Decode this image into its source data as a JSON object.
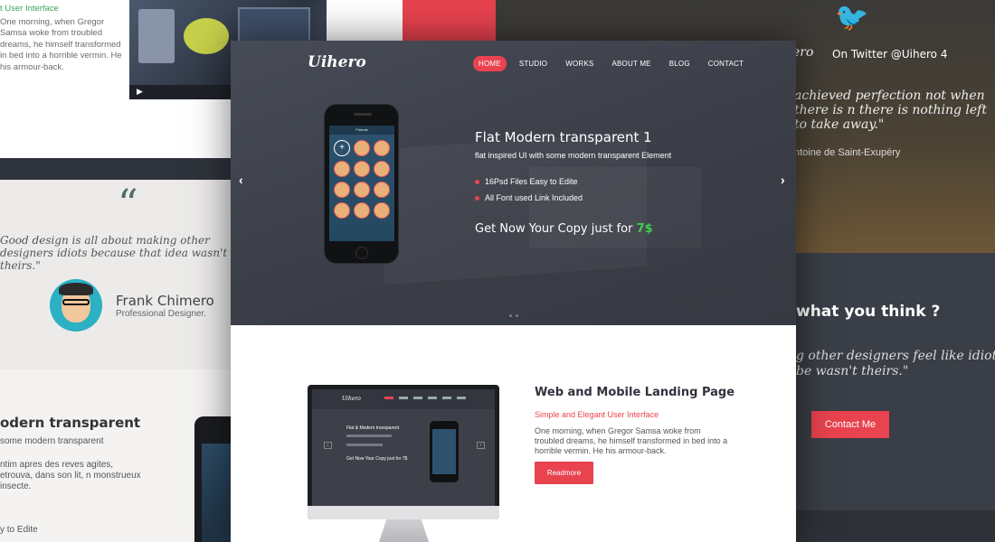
{
  "background": {
    "left_top": {
      "tag": "t User Interface",
      "body": "One morning, when Gregor Samsa woke from troubled dreams, he himself transformed in bed into a horrible vermin. He his armour-back."
    },
    "right_top": {
      "handle": "On Twitter @Uihero 4",
      "brand": "ero",
      "quote": "achieved perfection not when there is n there is nothing left to take away.\"",
      "author": "ntoine de Saint-Exupéry"
    },
    "left_mid": {
      "quote": "Good design is all about making other designers idiots because that idea wasn't theirs.\"",
      "name": "Frank Chimero",
      "role": "Professional Designer."
    },
    "left_bottom": {
      "heading": "odern transparent",
      "line1": "some modern transparent",
      "line2": "ntim apres des reves agites, etrouva, dans son lit, n monstrueux insecte.",
      "line3": "y to Edite"
    },
    "right_dark": {
      "heading": "what you think ?",
      "quote": "g other designers feel like idiots be wasn't theirs.\"",
      "button": "Contact Me"
    }
  },
  "header": {
    "logo": "Uihero",
    "nav": [
      {
        "label": "HOME",
        "active": true
      },
      {
        "label": "STUDIO",
        "active": false
      },
      {
        "label": "WORKS",
        "active": false
      },
      {
        "label": "ABOUT ME",
        "active": false
      },
      {
        "label": "BLOG",
        "active": false
      },
      {
        "label": "CONTACT",
        "active": false
      }
    ]
  },
  "slider": {
    "title": "Flat Modern transparent 1",
    "subtitle": "flat inspired UI with some modern transparent Element",
    "bullets": [
      "16Psd Files Easy to Edite",
      "All Font used Link Included"
    ],
    "cta_text": "Get Now Your Copy just for",
    "cta_price": "7$",
    "prev": "‹",
    "next": "›",
    "phone_title": "Friends"
  },
  "feature": {
    "title": "Web and Mobile Landing Page",
    "subtitle": "Simple and Elegant User Interface",
    "body": "One morning, when Gregor Samsa woke from troubled dreams, he himself transformed in bed into a horrible vermin. He his armour-back.",
    "button": "Readmore",
    "monitor": {
      "logo": "Uihero",
      "title": "Flat & Modern transparent",
      "cta": "Get Now Your Copy just for 7$"
    }
  },
  "colors": {
    "accent": "#e8434f",
    "price": "#3fd04f",
    "hero_bg": "#3e414a"
  }
}
